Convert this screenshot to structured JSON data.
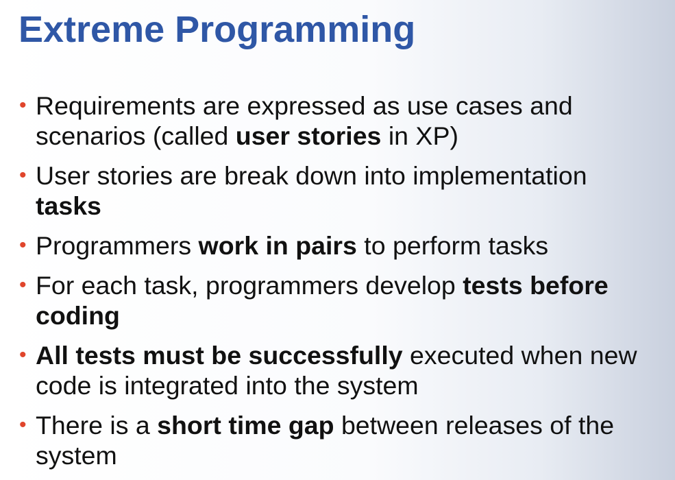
{
  "slide": {
    "title": "Extreme Programming",
    "bullet_char": "•",
    "accent_color": "#2f57a6",
    "bullet_color": "#e0452c",
    "bullets": [
      {
        "parts": [
          {
            "text": "Requirements are expressed as use cases and scenarios (called ",
            "bold": false
          },
          {
            "text": "user stories",
            "bold": true
          },
          {
            "text": " in XP)",
            "bold": false
          }
        ]
      },
      {
        "parts": [
          {
            "text": "User stories are break down into implementation ",
            "bold": false
          },
          {
            "text": "tasks",
            "bold": true
          }
        ]
      },
      {
        "parts": [
          {
            "text": "Programmers ",
            "bold": false
          },
          {
            "text": "work in pairs",
            "bold": true
          },
          {
            "text": " to perform tasks",
            "bold": false
          }
        ]
      },
      {
        "parts": [
          {
            "text": "For each task, programmers develop ",
            "bold": false
          },
          {
            "text": "tests before coding",
            "bold": true
          }
        ]
      },
      {
        "parts": [
          {
            "text": "All tests must be successfully",
            "bold": true
          },
          {
            "text": " executed when new code is integrated into the system",
            "bold": false
          }
        ]
      },
      {
        "parts": [
          {
            "text": "There is a ",
            "bold": false
          },
          {
            "text": "short time gap",
            "bold": true
          },
          {
            "text": " between releases of the system",
            "bold": false
          }
        ]
      }
    ]
  }
}
